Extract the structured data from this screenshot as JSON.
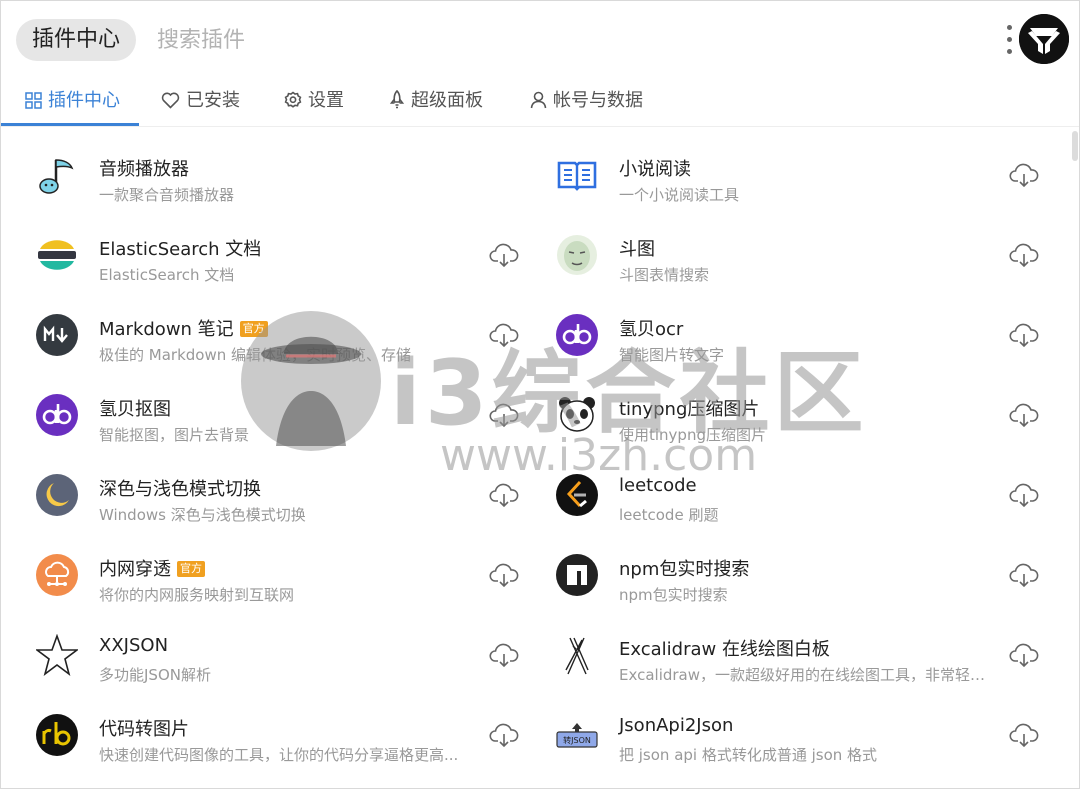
{
  "header": {
    "app_label": "插件中心",
    "search_placeholder": "搜索插件"
  },
  "tabs": [
    {
      "label": "插件中心",
      "icon": "grid-icon"
    },
    {
      "label": "已安装",
      "icon": "heart-icon"
    },
    {
      "label": "设置",
      "icon": "gear-icon"
    },
    {
      "label": "超级面板",
      "icon": "rocket-icon"
    },
    {
      "label": "帐号与数据",
      "icon": "user-icon"
    }
  ],
  "badge_label": "官方",
  "plugins_left": [
    {
      "title": "音频播放器",
      "desc": "一款聚合音频播放器",
      "icon": "music-note-icon"
    },
    {
      "title": "ElasticSearch 文档",
      "desc": "ElasticSearch 文档",
      "icon": "elasticsearch-icon"
    },
    {
      "title": "Markdown 笔记",
      "desc": "极佳的 Markdown 编辑体验，实时预览、存储",
      "icon": "markdown-icon",
      "official": true
    },
    {
      "title": "氢贝抠图",
      "desc": "智能抠图，图片去背景",
      "icon": "qingbei-icon"
    },
    {
      "title": "深色与浅色模式切换",
      "desc": "Windows 深色与浅色模式切换",
      "icon": "moon-icon"
    },
    {
      "title": "内网穿透",
      "desc": "将你的内网服务映射到互联网",
      "icon": "network-icon",
      "official": true
    },
    {
      "title": "XXJSON",
      "desc": "多功能JSON解析",
      "icon": "star-icon"
    },
    {
      "title": "代码转图片",
      "desc": "快速创建代码图像的工具，让你的代码分享逼格更高...",
      "icon": "rb-icon"
    }
  ],
  "plugins_right": [
    {
      "title": "小说阅读",
      "desc": "一个小说阅读工具",
      "icon": "book-icon"
    },
    {
      "title": "斗图",
      "desc": "斗图表情搜索",
      "icon": "meme-face-icon"
    },
    {
      "title": "氢贝ocr",
      "desc": "智能图片转文字",
      "icon": "qingbei-icon"
    },
    {
      "title": "tinypng压缩图片",
      "desc": "使用tinypng压缩图片",
      "icon": "panda-icon"
    },
    {
      "title": "leetcode",
      "desc": "leetcode 刷题",
      "icon": "leetcode-icon"
    },
    {
      "title": "npm包实时搜索",
      "desc": "npm包实时搜索",
      "icon": "npm-icon"
    },
    {
      "title": "Excalidraw 在线绘图白板",
      "desc": "Excalidraw，一款超级好用的在线绘图工具，非常轻量...",
      "icon": "excalidraw-icon"
    },
    {
      "title": "JsonApi2Json",
      "desc": "把 json api 格式转化成普通 json 格式",
      "icon": "json-converter-icon"
    }
  ],
  "watermark": {
    "text": "i3综合社区",
    "url": "www.i3zh.com"
  },
  "colors": {
    "accent": "#3b82d6",
    "badge": "#f0a020",
    "title_text": "#222222",
    "desc_text": "#999999"
  }
}
